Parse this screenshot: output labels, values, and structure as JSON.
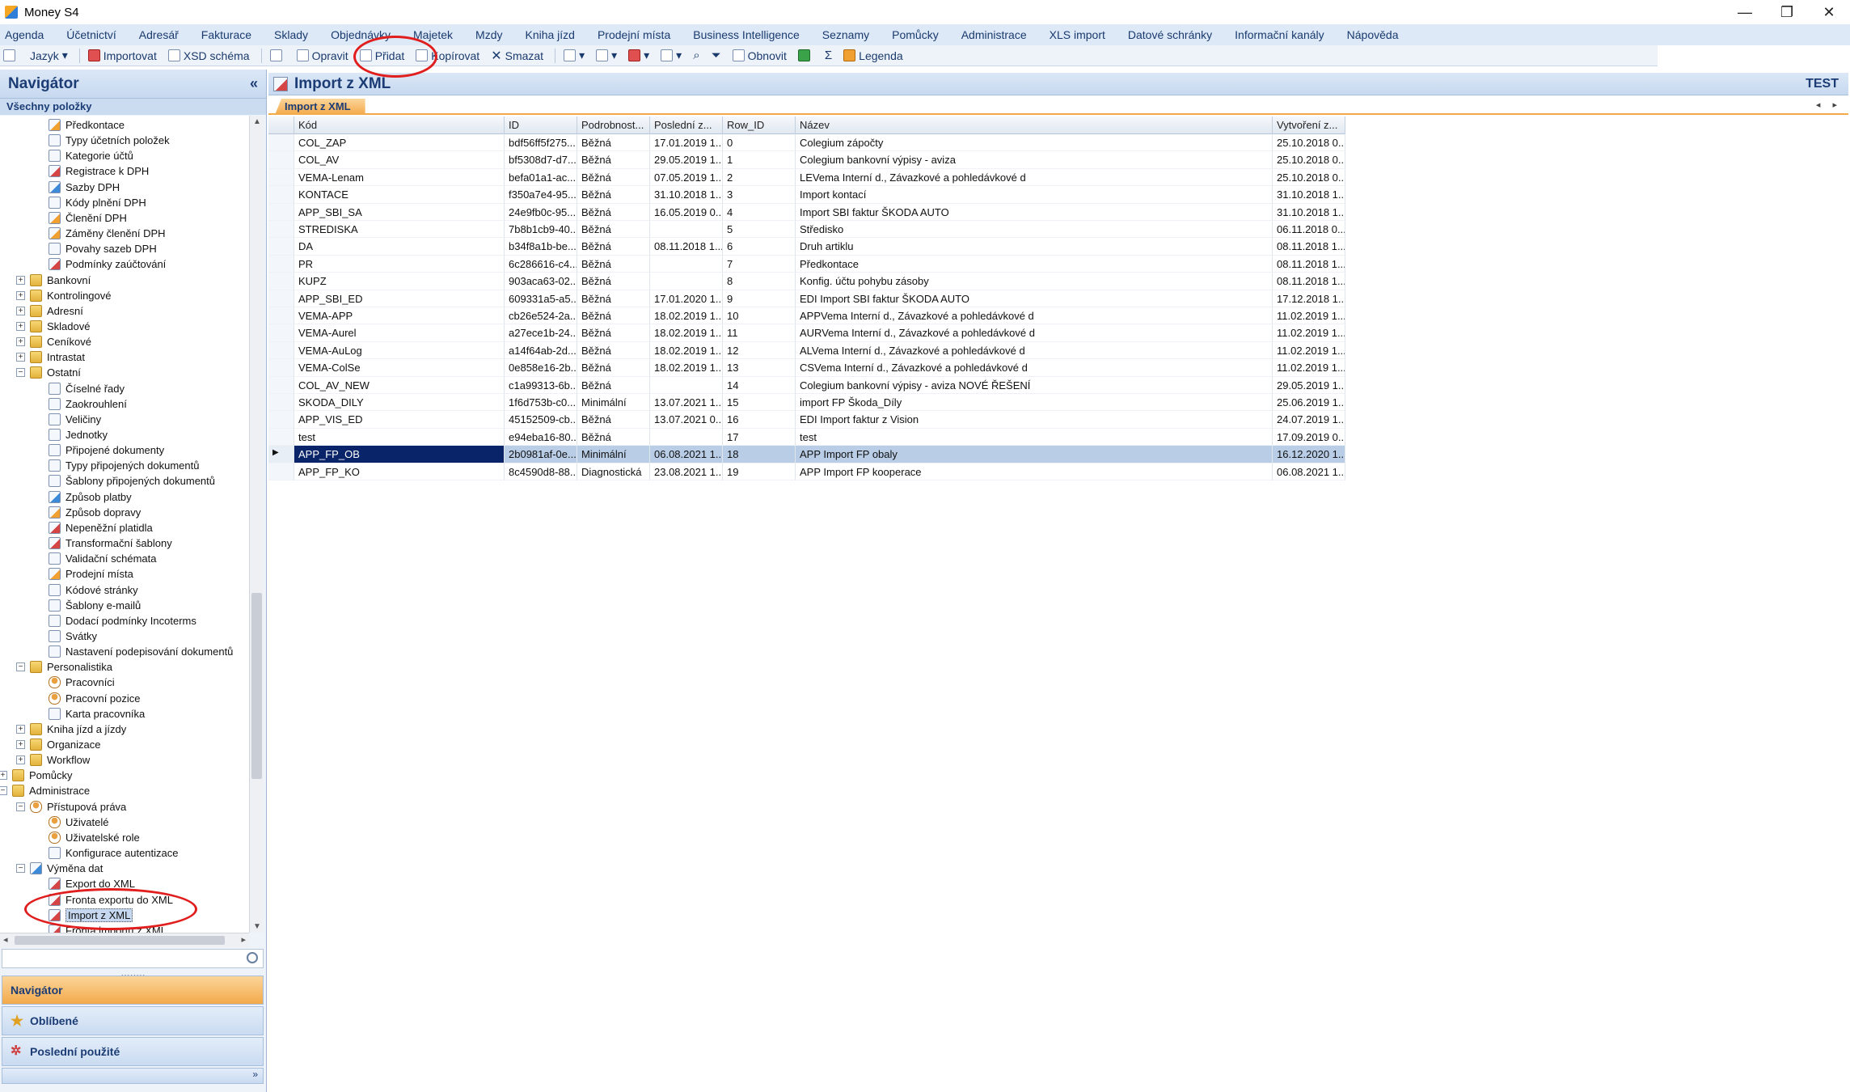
{
  "window": {
    "title": "Money S4",
    "buttons": [
      "—",
      "❐",
      "✕"
    ]
  },
  "menu": [
    "Agenda",
    "Účetnictví",
    "Adresář",
    "Fakturace",
    "Sklady",
    "Objednávky",
    "Majetek",
    "Mzdy",
    "Kniha jízd",
    "Prodejní místa",
    "Business Intelligence",
    "Seznamy",
    "Pomůcky",
    "Administrace",
    "XLS import",
    "Datové schránky",
    "Informační kanály",
    "Nápověda"
  ],
  "toolbar": {
    "jazyk": "Jazyk",
    "importovat": "Importovat",
    "xsd": "XSD schéma",
    "opravit": "Opravit",
    "pridat": "Přidat",
    "kopirovat": "Kopírovat",
    "smazat": "Smazat",
    "obnovit": "Obnovit",
    "sigma": "Σ",
    "legenda": "Legenda"
  },
  "navigator": {
    "title": "Navigátor",
    "collapse": "«",
    "subtitle": "Všechny položky",
    "tree": [
      {
        "label": "Předkontace",
        "level": 3,
        "icon": "doc4"
      },
      {
        "label": "Typy účetních položek",
        "level": 3,
        "icon": "doc"
      },
      {
        "label": "Kategorie účtů",
        "level": 3,
        "icon": "doc"
      },
      {
        "label": "Registrace k DPH",
        "level": 3,
        "icon": "doc2"
      },
      {
        "label": "Sazby DPH",
        "level": 3,
        "icon": "doc3"
      },
      {
        "label": "Kódy plnění DPH",
        "level": 3,
        "icon": "doc"
      },
      {
        "label": "Členění DPH",
        "level": 3,
        "icon": "doc4"
      },
      {
        "label": "Záměny členění DPH",
        "level": 3,
        "icon": "doc4"
      },
      {
        "label": "Povahy sazeb DPH",
        "level": 3,
        "icon": "doc"
      },
      {
        "label": "Podmínky zaúčtování",
        "level": 3,
        "icon": "doc2"
      },
      {
        "label": "Bankovní",
        "level": 2,
        "icon": "folder",
        "exp": "+"
      },
      {
        "label": "Kontrolingové",
        "level": 2,
        "icon": "folder",
        "exp": "+"
      },
      {
        "label": "Adresní",
        "level": 2,
        "icon": "folder",
        "exp": "+"
      },
      {
        "label": "Skladové",
        "level": 2,
        "icon": "folder",
        "exp": "+"
      },
      {
        "label": "Ceníkové",
        "level": 2,
        "icon": "folder",
        "exp": "+"
      },
      {
        "label": "Intrastat",
        "level": 2,
        "icon": "folder",
        "exp": "+"
      },
      {
        "label": "Ostatní",
        "level": 2,
        "icon": "folder",
        "exp": "−"
      },
      {
        "label": "Číselné řady",
        "level": 3,
        "icon": "doc"
      },
      {
        "label": "Zaokrouhlení",
        "level": 3,
        "icon": "doc"
      },
      {
        "label": "Veličiny",
        "level": 3,
        "icon": "doc"
      },
      {
        "label": "Jednotky",
        "level": 3,
        "icon": "doc"
      },
      {
        "label": "Připojené dokumenty",
        "level": 3,
        "icon": "doc"
      },
      {
        "label": "Typy připojených dokumentů",
        "level": 3,
        "icon": "doc"
      },
      {
        "label": "Šablony připojených dokumentů",
        "level": 3,
        "icon": "doc"
      },
      {
        "label": "Způsob platby",
        "level": 3,
        "icon": "doc3"
      },
      {
        "label": "Způsob dopravy",
        "level": 3,
        "icon": "doc4"
      },
      {
        "label": "Nepeněžní platidla",
        "level": 3,
        "icon": "doc2"
      },
      {
        "label": "Transformační šablony",
        "level": 3,
        "icon": "doc2"
      },
      {
        "label": "Validační schémata",
        "level": 3,
        "icon": "doc"
      },
      {
        "label": "Prodejní místa",
        "level": 3,
        "icon": "doc4"
      },
      {
        "label": "Kódové stránky",
        "level": 3,
        "icon": "doc"
      },
      {
        "label": "Šablony e-mailů",
        "level": 3,
        "icon": "doc"
      },
      {
        "label": "Dodací podmínky Incoterms",
        "level": 3,
        "icon": "doc"
      },
      {
        "label": "Svátky",
        "level": 3,
        "icon": "doc"
      },
      {
        "label": "Nastavení podepisování dokumentů",
        "level": 3,
        "icon": "doc"
      },
      {
        "label": "Personalistika",
        "level": 2,
        "icon": "folder",
        "exp": "−"
      },
      {
        "label": "Pracovníci",
        "level": 3,
        "icon": "user"
      },
      {
        "label": "Pracovní pozice",
        "level": 3,
        "icon": "user"
      },
      {
        "label": "Karta pracovníka",
        "level": 3,
        "icon": "doc"
      },
      {
        "label": "Kniha jízd a jízdy",
        "level": 2,
        "icon": "folder",
        "exp": "+"
      },
      {
        "label": "Organizace",
        "level": 2,
        "icon": "folder",
        "exp": "+"
      },
      {
        "label": "Workflow",
        "level": 2,
        "icon": "folder",
        "exp": "+"
      },
      {
        "label": "Pomůcky",
        "level": 1,
        "icon": "folder",
        "exp": "+"
      },
      {
        "label": "Administrace",
        "level": 1,
        "icon": "folder",
        "exp": "−"
      },
      {
        "label": "Přístupová práva",
        "level": 2,
        "icon": "user",
        "exp": "−"
      },
      {
        "label": "Uživatelé",
        "level": 3,
        "icon": "user"
      },
      {
        "label": "Uživatelské role",
        "level": 3,
        "icon": "user"
      },
      {
        "label": "Konfigurace autentizace",
        "level": 3,
        "icon": "doc"
      },
      {
        "label": "Výměna dat",
        "level": 2,
        "icon": "doc3",
        "exp": "−"
      },
      {
        "label": "Export do XML",
        "level": 3,
        "icon": "doc2"
      },
      {
        "label": "Fronta exportu do XML",
        "level": 3,
        "icon": "doc2"
      },
      {
        "label": "Import z XML",
        "level": 3,
        "icon": "doc2",
        "selected": true
      },
      {
        "label": "Fronta importu z XML",
        "level": 3,
        "icon": "doc2"
      }
    ],
    "tabs": {
      "navigator": "Navigátor",
      "oblibene": "Oblíbené",
      "posledni": "Poslední použité"
    },
    "grip": "........",
    "bottom_arrow": "»"
  },
  "main": {
    "title": "Import z XML",
    "environment": "TEST",
    "tab": "Import z XML",
    "tab_arrows": "◂ ▸",
    "columns": [
      "",
      "Kód",
      "ID",
      "Podrobnost...",
      "Poslední z...",
      "Row_ID",
      "Název",
      "Vytvoření z..."
    ],
    "rows": [
      {
        "kod": "COL_ZAP",
        "id": "bdf56ff5f275...",
        "podrobnost": "Běžná",
        "posledni": "17.01.2019 1...",
        "row_id": "0",
        "nazev": "Colegium zápočty",
        "vytvoreni": "25.10.2018 0..."
      },
      {
        "kod": "COL_AV",
        "id": "bf5308d7-d7...",
        "podrobnost": "Běžná",
        "posledni": "29.05.2019 1...",
        "row_id": "1",
        "nazev": "Colegium bankovní výpisy - aviza",
        "vytvoreni": "25.10.2018 0..."
      },
      {
        "kod": "VEMA-Lenam",
        "id": "befa01a1-ac...",
        "podrobnost": "Běžná",
        "posledni": "07.05.2019 1...",
        "row_id": "2",
        "nazev": "LEVema Interní d., Závazkové a pohledávkové d",
        "vytvoreni": "25.10.2018 0..."
      },
      {
        "kod": "KONTACE",
        "id": "f350a7e4-95...",
        "podrobnost": "Běžná",
        "posledni": "31.10.2018 1...",
        "row_id": "3",
        "nazev": "Import kontací",
        "vytvoreni": "31.10.2018 1..."
      },
      {
        "kod": "APP_SBI_SA",
        "id": "24e9fb0c-95...",
        "podrobnost": "Běžná",
        "posledni": "16.05.2019 0...",
        "row_id": "4",
        "nazev": "Import SBI faktur ŠKODA AUTO",
        "vytvoreni": "31.10.2018 1..."
      },
      {
        "kod": "STREDISKA",
        "id": "7b8b1cb9-40...",
        "podrobnost": "Běžná",
        "posledni": "",
        "row_id": "5",
        "nazev": "Středisko",
        "vytvoreni": "06.11.2018 0..."
      },
      {
        "kod": "DA",
        "id": "b34f8a1b-be...",
        "podrobnost": "Běžná",
        "posledni": "08.11.2018 1...",
        "row_id": "6",
        "nazev": "Druh artiklu",
        "vytvoreni": "08.11.2018 1..."
      },
      {
        "kod": "PR",
        "id": "6c286616-c4...",
        "podrobnost": "Běžná",
        "posledni": "",
        "row_id": "7",
        "nazev": "Předkontace",
        "vytvoreni": "08.11.2018 1..."
      },
      {
        "kod": "KUPZ",
        "id": "903aca63-02...",
        "podrobnost": "Běžná",
        "posledni": "",
        "row_id": "8",
        "nazev": "Konfig. účtu pohybu zásoby",
        "vytvoreni": "08.11.2018 1..."
      },
      {
        "kod": "APP_SBI_ED",
        "id": "609331a5-a5...",
        "podrobnost": "Běžná",
        "posledni": "17.01.2020 1...",
        "row_id": "9",
        "nazev": "EDI Import SBI faktur ŠKODA AUTO",
        "vytvoreni": "17.12.2018 1..."
      },
      {
        "kod": "VEMA-APP",
        "id": "cb26e524-2a...",
        "podrobnost": "Běžná",
        "posledni": "18.02.2019 1...",
        "row_id": "10",
        "nazev": "APPVema Interní d., Závazkové a pohledávkové d",
        "vytvoreni": "11.02.2019 1..."
      },
      {
        "kod": "VEMA-Aurel",
        "id": "a27ece1b-24...",
        "podrobnost": "Běžná",
        "posledni": "18.02.2019 1...",
        "row_id": "11",
        "nazev": "AURVema Interní d., Závazkové a pohledávkové d",
        "vytvoreni": "11.02.2019 1..."
      },
      {
        "kod": "VEMA-AuLog",
        "id": "a14f64ab-2d...",
        "podrobnost": "Běžná",
        "posledni": "18.02.2019 1...",
        "row_id": "12",
        "nazev": "ALVema Interní d., Závazkové a pohledávkové d",
        "vytvoreni": "11.02.2019 1..."
      },
      {
        "kod": "VEMA-ColSe",
        "id": "0e858e16-2b...",
        "podrobnost": "Běžná",
        "posledni": "18.02.2019 1...",
        "row_id": "13",
        "nazev": "CSVema Interní d., Závazkové a pohledávkové d",
        "vytvoreni": "11.02.2019 1..."
      },
      {
        "kod": "COL_AV_NEW",
        "id": "c1a99313-6b...",
        "podrobnost": "Běžná",
        "posledni": "",
        "row_id": "14",
        "nazev": "Colegium bankovní výpisy - aviza NOVÉ ŘEŠENÍ",
        "vytvoreni": "29.05.2019 1..."
      },
      {
        "kod": "SKODA_DILY",
        "id": "1f6d753b-c0...",
        "podrobnost": "Minimální",
        "posledni": "13.07.2021 1...",
        "row_id": "15",
        "nazev": "import FP Škoda_Díly",
        "vytvoreni": "25.06.2019 1..."
      },
      {
        "kod": "APP_VIS_ED",
        "id": "45152509-cb...",
        "podrobnost": "Běžná",
        "posledni": "13.07.2021 0...",
        "row_id": "16",
        "nazev": "EDI Import faktur z Vision",
        "vytvoreni": "24.07.2019 1..."
      },
      {
        "kod": "test",
        "id": "e94eba16-80...",
        "podrobnost": "Běžná",
        "posledni": "",
        "row_id": "17",
        "nazev": "test",
        "vytvoreni": "17.09.2019 0..."
      },
      {
        "kod": "APP_FP_OB",
        "id": "2b0981af-0e...",
        "podrobnost": "Minimální",
        "posledni": "06.08.2021 1...",
        "row_id": "18",
        "nazev": "APP Import FP obaly",
        "vytvoreni": "16.12.2020 1...",
        "selected": true
      },
      {
        "kod": "APP_FP_KO",
        "id": "8c4590d8-88...",
        "podrobnost": "Diagnostická",
        "posledni": "23.08.2021 1...",
        "row_id": "19",
        "nazev": "APP Import FP kooperace",
        "vytvoreni": "06.08.2021 1..."
      }
    ],
    "row_indicator": "▶"
  },
  "colors": {
    "accent_orange": "#f3a94a",
    "navy_header": "#1c3c75",
    "selection": "#0a246a",
    "annotation_red": "#e01e1e"
  }
}
